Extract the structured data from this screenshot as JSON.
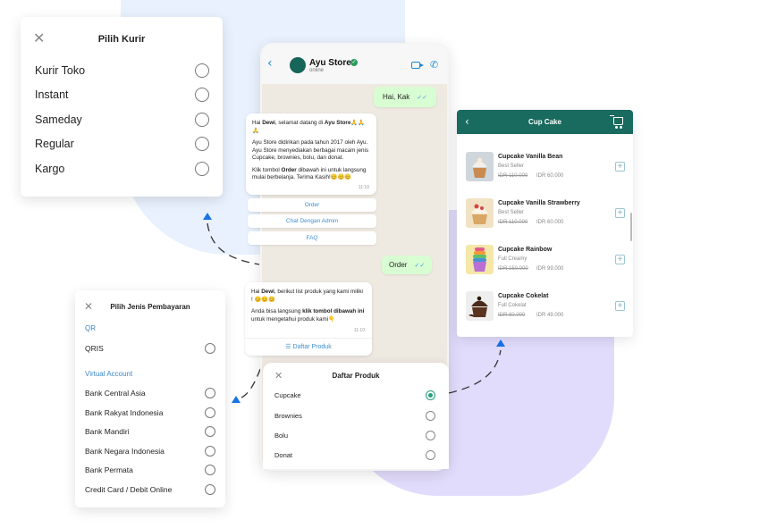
{
  "kurir": {
    "title": "Pilih Kurir",
    "options": [
      "Kurir Toko",
      "Instant",
      "Sameday",
      "Regular",
      "Kargo"
    ]
  },
  "payment": {
    "title": "Pilih Jenis Pembayaran",
    "section_qr": "QR",
    "qr_options": [
      "QRIS"
    ],
    "section_va": "Virtual Account",
    "va_options": [
      "Bank Central Asia",
      "Bank Rakyat Indonesia",
      "Bank Mandiri",
      "Bank Negara Indonesia",
      "Bank Permata",
      "Credit Card / Debit Online"
    ]
  },
  "chat": {
    "contact_name": "Ayu Store",
    "contact_status": "online",
    "msg_out_1": "Hai, Kak",
    "welcome": {
      "greeting_pre": "Hai ",
      "greeting_name": "Dewi",
      "greeting_mid": ", selamat datang di ",
      "greeting_store": "Ayu Store",
      "greeting_emoji": "🙏🙏🙏",
      "para2": "Ayu Store didirikan pada tahun 2017 oleh Ayu. Ayu Store menyediakan berbagai macam jenis Cupcake, brownies, bolu, dan donat.",
      "para3_pre": "Klik tombol ",
      "para3_bold": "Order",
      "para3_post": " dibawah ini untuk langsung mulai berbelanja. Terima Kasih!",
      "para3_emoji": "😊😊😊",
      "time": "11:10"
    },
    "quick_replies": [
      "Order",
      "Chat Dengan Admin",
      "FAQ"
    ],
    "msg_out_2": "Order",
    "list_msg": {
      "line1_pre": "Hai ",
      "line1_name": "Dewi",
      "line1_post": ", berikut list produk yang kami miliki !",
      "line1_emoji": "😊😊😊",
      "line2_pre": "Anda bisa langsung ",
      "line2_bold": "klik tombol dibawah ini",
      "line2_post": " untuk mengetahui produk kami",
      "line2_emoji": "👇",
      "time": "11:10",
      "button": "Daftar Produk"
    }
  },
  "product_sheet": {
    "title": "Daftar Produk",
    "options": [
      "Cupcake",
      "Brownies",
      "Bolu",
      "Donat"
    ],
    "selected": "Cupcake"
  },
  "catalog": {
    "title": "Cup Cake",
    "items": [
      {
        "name": "Cupcake Vanilla Bean",
        "tag": "Best Seller",
        "old_price": "IDR 110.000",
        "price": "IDR 60.000"
      },
      {
        "name": "Cupcake Vanilla Strawberry",
        "tag": "Best Seller",
        "old_price": "IDR 110.000",
        "price": "IDR 60.000"
      },
      {
        "name": "Cupcake Rainbow",
        "tag": "Full Creamy",
        "old_price": "IDR 150.000",
        "price": "IDR 99.000"
      },
      {
        "name": "Cupcake Cokelat",
        "tag": "Full Cokelat",
        "old_price": "IDR 80.000",
        "price": "IDR 49.000"
      }
    ]
  },
  "colors": {
    "whatsapp_green": "#186b5e",
    "outgoing_bubble": "#d9fdd3",
    "link_blue": "#3d8ed0",
    "connector_blue": "#1a73e8"
  }
}
